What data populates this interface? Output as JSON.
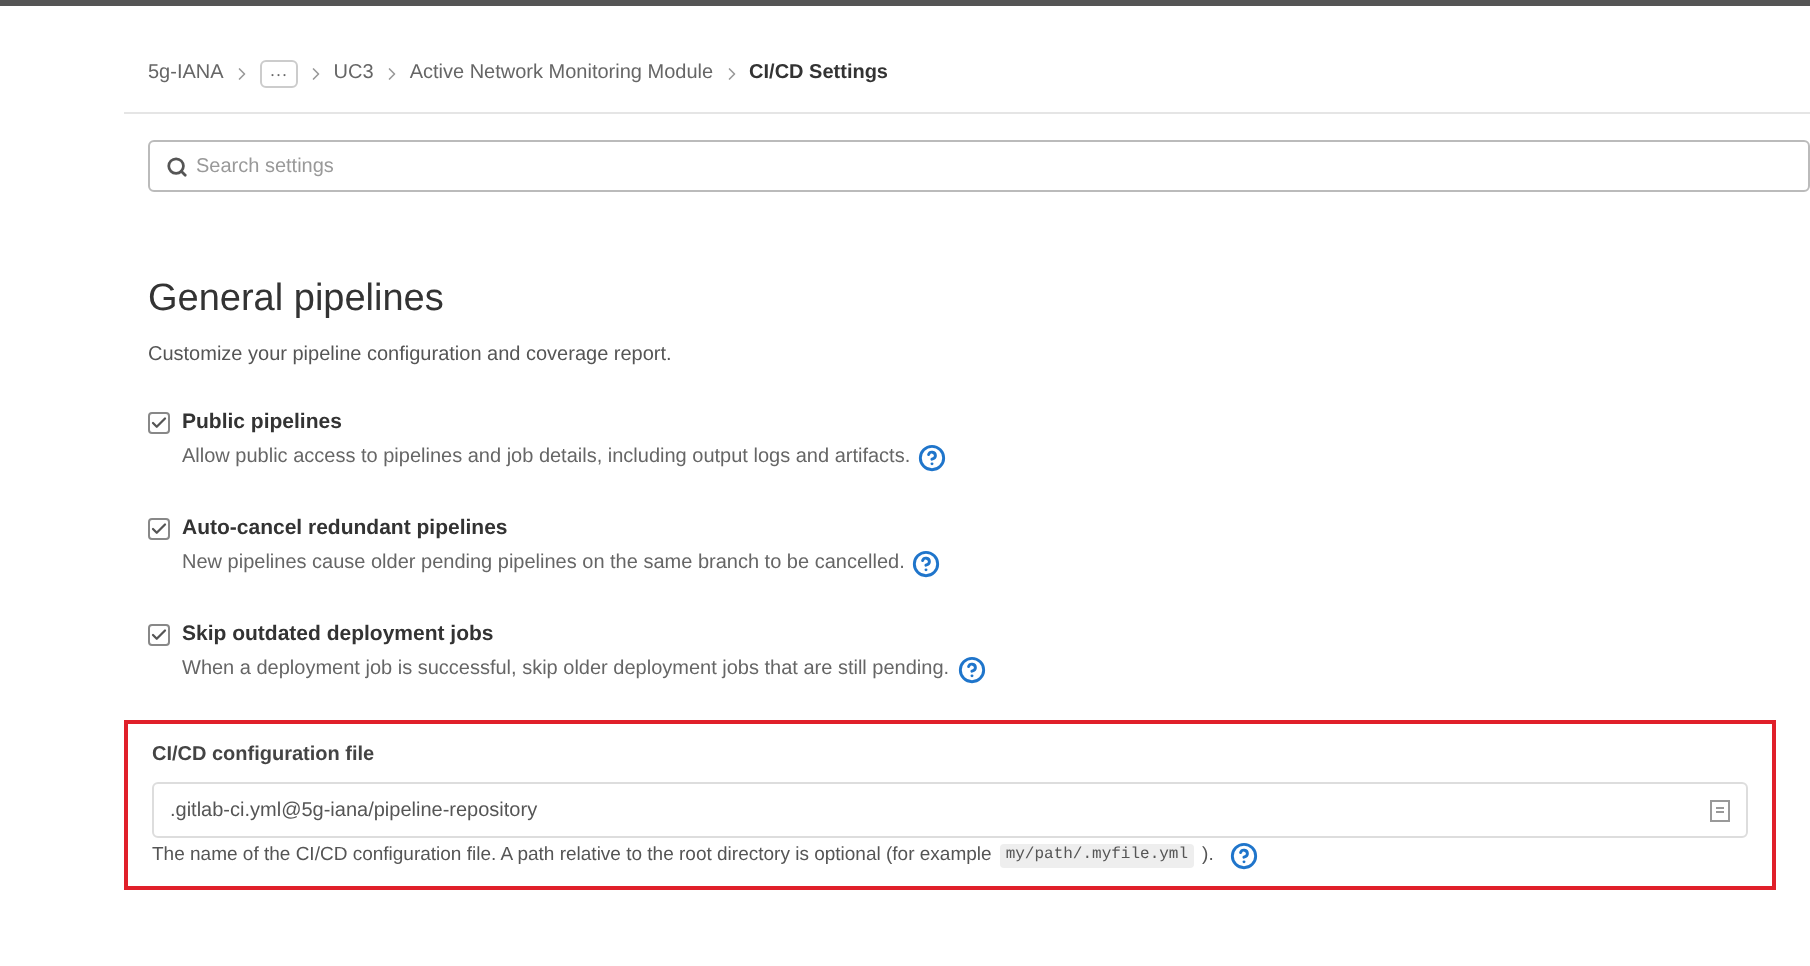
{
  "breadcrumbs": [
    {
      "kind": "link",
      "label": "5g-IANA"
    },
    {
      "kind": "more",
      "label": "···"
    },
    {
      "kind": "link",
      "label": "UC3"
    },
    {
      "kind": "link",
      "label": "Active Network Monitoring Module"
    },
    {
      "kind": "current",
      "label": "CI/CD Settings"
    }
  ],
  "search": {
    "placeholder": "Search settings"
  },
  "section": {
    "title": "General pipelines",
    "description": "Customize your pipeline configuration and coverage report."
  },
  "options": [
    {
      "label": "Public pipelines",
      "help": "Allow public access to pipelines and job details, including output logs and artifacts.",
      "checked": true
    },
    {
      "label": "Auto-cancel redundant pipelines",
      "help": "New pipelines cause older pending pipelines on the same branch to be cancelled.",
      "checked": true
    },
    {
      "label": "Skip outdated deployment jobs",
      "help": "When a deployment job is successful, skip older deployment jobs that are still pending.",
      "checked": true
    }
  ],
  "config_file": {
    "label": "CI/CD configuration file",
    "value": ".gitlab-ci.yml@5g-iana/pipeline-repository",
    "help_before": "The name of the CI/CD configuration file. A path relative to the root directory is optional (for example",
    "example": "my/path/.myfile.yml",
    "help_after": ").",
    "highlighted": true
  }
}
